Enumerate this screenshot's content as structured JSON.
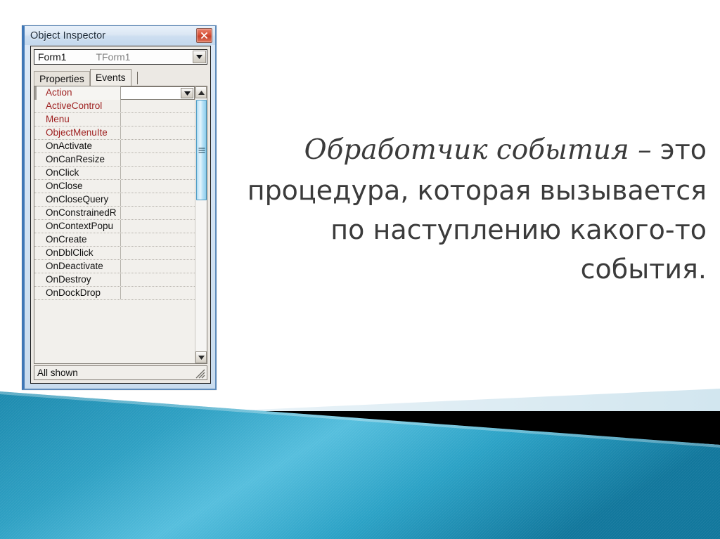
{
  "slide": {
    "body_lead": "Обработчик события –",
    "body_rest": "это процедура, которая вызывается по наступлению какого-то события."
  },
  "inspector": {
    "title": "Object Inspector",
    "close_icon": "close-icon",
    "component": {
      "name": "Form1",
      "class": "TForm1",
      "dropdown_icon": "chevron-down-icon"
    },
    "tabs": [
      {
        "label": "Properties",
        "active": false
      },
      {
        "label": "Events",
        "active": true
      }
    ],
    "grid": {
      "selected_index": 0,
      "selected_value": "",
      "value_dropdown_icon": "chevron-down-icon",
      "rows": [
        {
          "name": "Action",
          "color": "red"
        },
        {
          "name": "ActiveControl",
          "color": "red"
        },
        {
          "name": "Menu",
          "color": "red"
        },
        {
          "name": "ObjectMenuIte",
          "color": "red"
        },
        {
          "name": "OnActivate",
          "color": "black"
        },
        {
          "name": "OnCanResize",
          "color": "black"
        },
        {
          "name": "OnClick",
          "color": "black"
        },
        {
          "name": "OnClose",
          "color": "black"
        },
        {
          "name": "OnCloseQuery",
          "color": "black"
        },
        {
          "name": "OnConstrainedR",
          "color": "black"
        },
        {
          "name": "OnContextPopu",
          "color": "black"
        },
        {
          "name": "OnCreate",
          "color": "black"
        },
        {
          "name": "OnDblClick",
          "color": "black"
        },
        {
          "name": "OnDeactivate",
          "color": "black"
        },
        {
          "name": "OnDestroy",
          "color": "black"
        },
        {
          "name": "OnDockDrop",
          "color": "black"
        }
      ]
    },
    "scrollbar": {
      "up_icon": "triangle-up-icon",
      "down_icon": "triangle-down-icon",
      "thumb_grip_icon": "grip-lines-icon"
    },
    "statusbar": {
      "text": "All shown",
      "grip_icon": "resize-grip-icon"
    }
  },
  "colors": {
    "teal": "#1b8fb3",
    "teal_light": "#53b7d8",
    "pale_blue": "#dce9f0",
    "black": "#000000",
    "property_red": "#9e1f1f",
    "title_blue": "#3f77b6"
  }
}
